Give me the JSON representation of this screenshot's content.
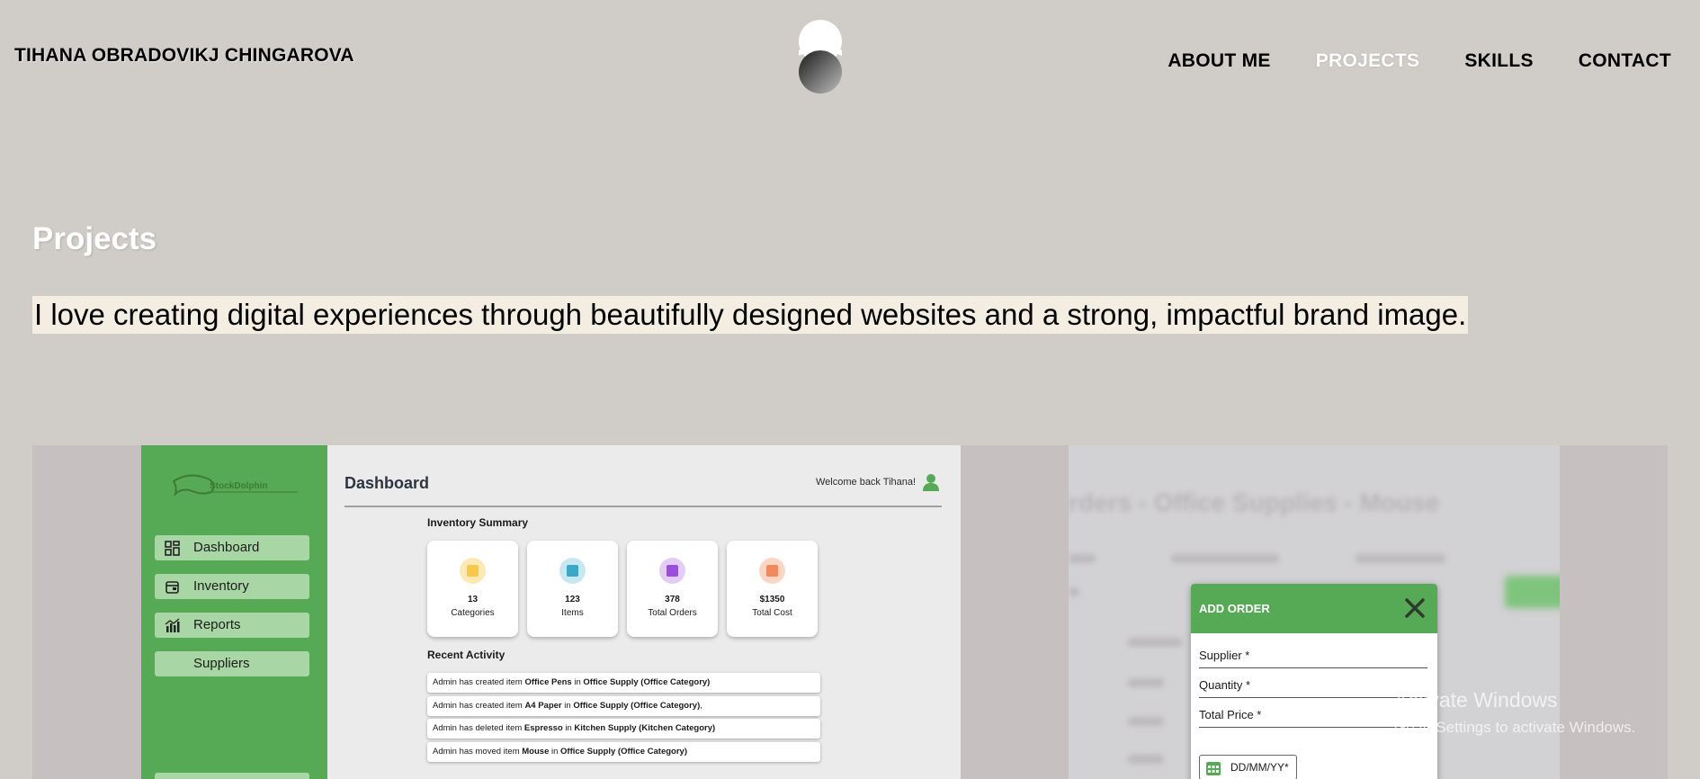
{
  "header": {
    "name": "TIHANA OBRADOVIKJ CHINGAROVA",
    "logo_icon": "yin-yang-logo-icon",
    "nav": [
      {
        "label": "ABOUT ME",
        "active": false
      },
      {
        "label": "PROJECTS",
        "active": true
      },
      {
        "label": "SKILLS",
        "active": false
      },
      {
        "label": "CONTACT",
        "active": false
      }
    ]
  },
  "main": {
    "title": "Projects",
    "tagline": "I love creating digital experiences through beautifully designed websites and a strong, impactful brand image."
  },
  "project_dashboard": {
    "logo_text": "StockDolphin",
    "sidebar": [
      {
        "label": "Dashboard",
        "icon": "grid-icon"
      },
      {
        "label": "Inventory",
        "icon": "box-icon"
      },
      {
        "label": "Reports",
        "icon": "bar-chart-icon"
      },
      {
        "label": "Suppliers",
        "icon": ""
      }
    ],
    "title": "Dashboard",
    "welcome": "Welcome back Tihana!",
    "inventory_title": "Inventory Summary",
    "stats": [
      {
        "value": "13",
        "label": "Categories",
        "color": "#f7c948",
        "bg": "#fde9b3"
      },
      {
        "value": "123",
        "label": "Items",
        "color": "#3ba7c9",
        "bg": "#c7e7f1"
      },
      {
        "value": "378",
        "label": "Total Orders",
        "color": "#9b4de0",
        "bg": "#e3cdf7"
      },
      {
        "value": "$1350",
        "label": "Total Cost",
        "color": "#f08a5d",
        "bg": "#fcd6c4"
      }
    ],
    "recent_title": "Recent Activity",
    "activities": [
      {
        "pre": "Admin has created item ",
        "item": "Office Pens",
        "mid": " in ",
        "cat": "Office Supply (Office Category)",
        "post": ""
      },
      {
        "pre": "Admin has created item ",
        "item": "A4 Paper",
        "mid": " in ",
        "cat": "Office Supply (Office Category)",
        "post": ","
      },
      {
        "pre": "Admin has deleted item ",
        "item": "Espresso",
        "mid": " in ",
        "cat": "Kitchen Supply (Kitchen Category)",
        "post": ""
      },
      {
        "pre": "Admin has moved item ",
        "item": "Mouse",
        "mid": " in ",
        "cat": "Office Supply (Office Category)",
        "post": ""
      }
    ]
  },
  "project_order": {
    "blurred_heading": "rders - Office Supplies - Mouse",
    "modal_title": "ADD ORDER",
    "fields": [
      "Supplier *",
      "Quantity *",
      "Total Price *"
    ],
    "date_placeholder": "DD/MM/YY*"
  },
  "watermark": {
    "line1": "Activate Windows",
    "line2": "Go to Settings to activate Windows."
  }
}
